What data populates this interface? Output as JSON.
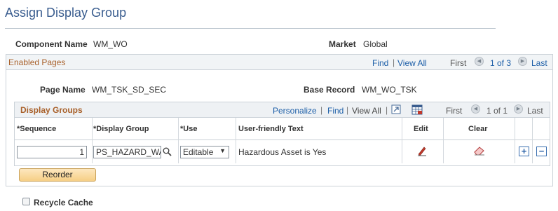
{
  "page": {
    "title": "Assign Display Group"
  },
  "header_fields": {
    "component_name_label": "Component Name",
    "component_name_value": "WM_WO",
    "market_label": "Market",
    "market_value": "Global"
  },
  "enabled_pages": {
    "title": "Enabled Pages",
    "find": "Find",
    "view_all": "View All",
    "first": "First",
    "range": "1 of 3",
    "last": "Last",
    "page_name_label": "Page Name",
    "page_name_value": "WM_TSK_SD_SEC",
    "base_record_label": "Base Record",
    "base_record_value": "WM_WO_TSK"
  },
  "display_groups": {
    "title": "Display Groups",
    "personalize": "Personalize",
    "find": "Find",
    "view_all": "View All",
    "first": "First",
    "range": "1 of 1",
    "last": "Last",
    "columns": {
      "sequence": "*Sequence",
      "display_group": "*Display Group",
      "use": "*Use",
      "friendly_text": "User-friendly Text",
      "edit": "Edit",
      "clear": "Clear"
    },
    "rows": [
      {
        "sequence": "1",
        "display_group": "PS_HAZARD_WAM",
        "use": "Editable",
        "friendly_text": "Hazardous Asset is Yes"
      }
    ]
  },
  "buttons": {
    "reorder": "Reorder"
  },
  "recycle_cache": {
    "label": "Recycle Cache",
    "checked": false
  },
  "icons": {
    "nav_prev": "circle-left-arrow-icon",
    "nav_next": "circle-right-arrow-icon",
    "lookup": "magnifier-icon",
    "edit": "pencil-icon",
    "clear": "eraser-icon",
    "add_row": "plus-icon",
    "delete_row": "minus-icon",
    "zoom": "zoom-grid-icon",
    "download": "spreadsheet-icon"
  },
  "colors": {
    "title_blue": "#3a5d8f",
    "link_blue": "#1d5fa8",
    "section_orange": "#a9612b"
  }
}
